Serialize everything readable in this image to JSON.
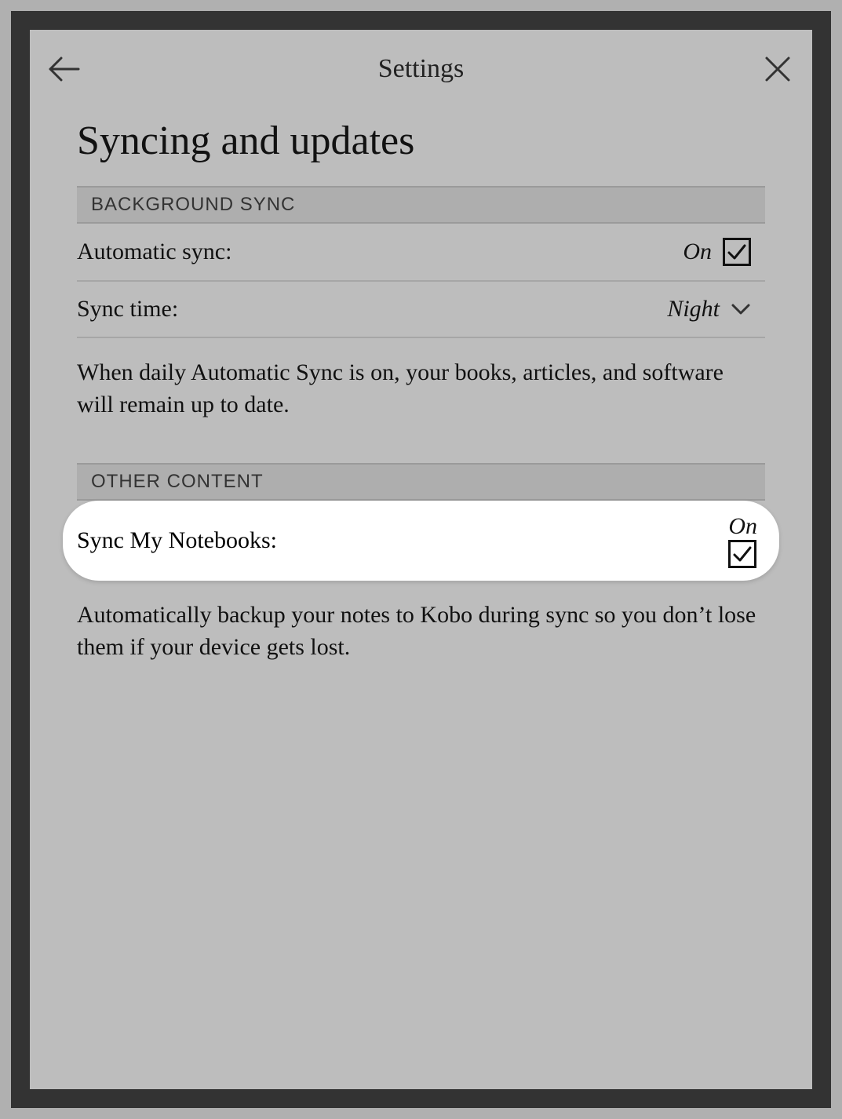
{
  "header": {
    "title": "Settings"
  },
  "page": {
    "title": "Syncing and updates"
  },
  "sections": {
    "background_sync": {
      "header": "BACKGROUND SYNC",
      "automatic_sync": {
        "label": "Automatic sync:",
        "value": "On",
        "checked": true
      },
      "sync_time": {
        "label": "Sync time:",
        "value": "Night"
      },
      "description": "When daily Automatic Sync is on, your books, articles, and software will remain up to date."
    },
    "other_content": {
      "header": "OTHER CONTENT",
      "sync_notebooks": {
        "label": "Sync My Notebooks:",
        "value": "On",
        "checked": true
      },
      "description": "Automatically backup your notes to Kobo during sync so you don’t lose them if your device gets lost."
    }
  }
}
